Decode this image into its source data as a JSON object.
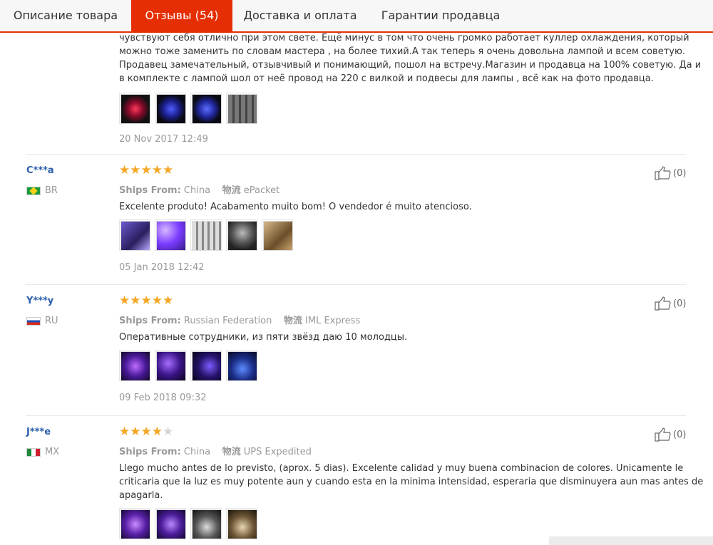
{
  "tabs": [
    {
      "label": "Описание товара"
    },
    {
      "label": "Отзывы (54)"
    },
    {
      "label": "Доставка и оплата"
    },
    {
      "label": "Гарантии продавца"
    }
  ],
  "first_review": {
    "text_lines": [
      "чувствуют себя отлично при этом свете. Ещё минус в том что очень громко работает куллер охлаждения, который",
      "можно тоже заменить по словам мастера , на более тихий.А так теперь я очень довольна лампой и всем советую.",
      "Продавец замечательный, отзывчивый и понимающий, пошол на встречу.Магазин и продавца на 100% советую. Да и",
      "в комплекте с лампой шол от неё провод на 220 с вилкой и подвесы для лампы , всё как на фото продавца."
    ],
    "date": "20 Nov 2017 12:49"
  },
  "labels": {
    "ships_from": "Ships From:",
    "logistics": "物流"
  },
  "reviews": [
    {
      "user": "C***a",
      "country": "BR",
      "rating": 5,
      "ships_from": "China",
      "logistics": "ePacket",
      "text_lines": [
        "Excelente produto! Acabamento muito bom! O vendedor é muito atencioso."
      ],
      "date": "05 Jan 2018 12:42",
      "likes": "(0)"
    },
    {
      "user": "Y***y",
      "country": "RU",
      "rating": 5,
      "ships_from": "Russian Federation",
      "logistics": "IML Express",
      "text_lines": [
        "Оперативные сотрудники, из пяти звёзд даю 10 молодцы."
      ],
      "date": "09 Feb 2018 09:32",
      "likes": "(0)"
    },
    {
      "user": "J***e",
      "country": "MX",
      "rating": 4,
      "ships_from": "China",
      "logistics": "UPS Expedited",
      "text_lines": [
        "Llego mucho antes de lo previsto, (aprox. 5 dias). Excelente calidad y muy buena combinacion de colores. Unicamente le",
        "criticaria que la luz es muy potente aun y cuando esta en la minima intensidad, esperaria que disminuyera aun mas antes de",
        "apagarla."
      ],
      "likes": "(0)"
    }
  ],
  "colors": {
    "accent": "#e62e04",
    "star": "#f5a623",
    "user": "#2a5dab"
  }
}
